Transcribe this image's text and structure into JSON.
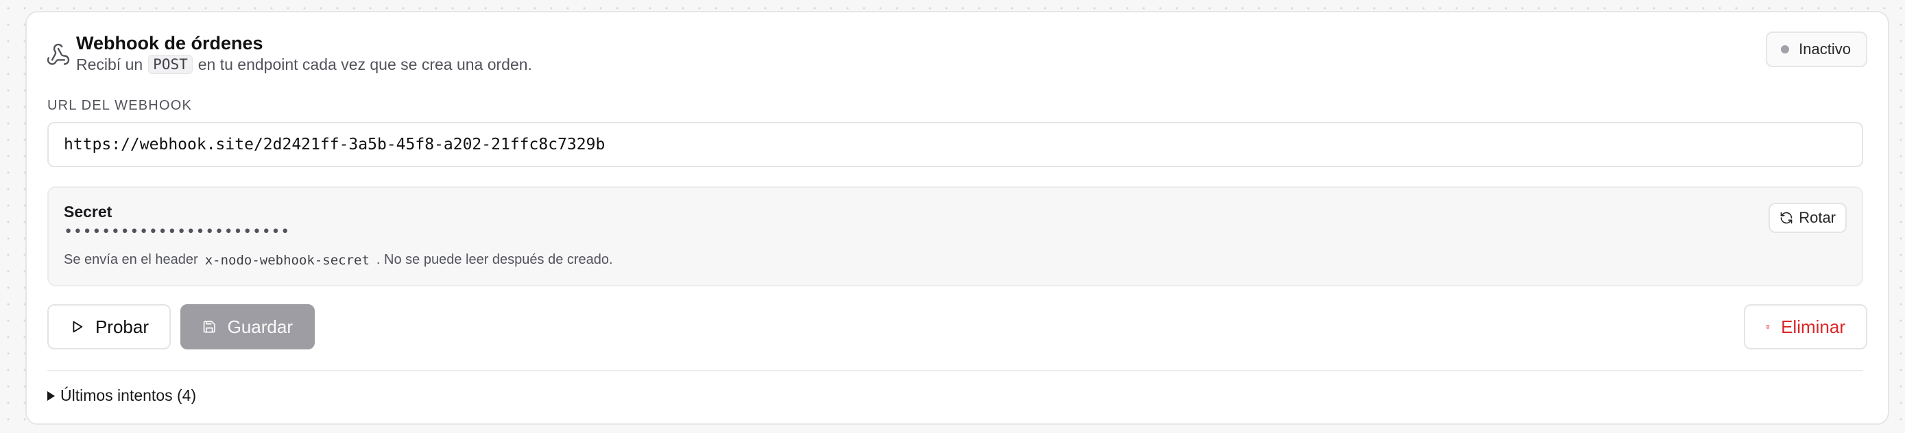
{
  "webhook": {
    "title": "Webhook de órdenes",
    "subtitle_pre": "Recibí un",
    "subtitle_method": "POST",
    "subtitle_post": "en tu endpoint cada vez que se crea una orden.",
    "status": "Inactivo",
    "status_color": "#a1a1aa"
  },
  "url": {
    "label": "URL DEL WEBHOOK",
    "value": "https://webhook.site/2d2421ff-3a5b-45f8-a202-21ffc8c7329b"
  },
  "secret": {
    "label": "Secret",
    "masked": "••••••••••••••••••••••••",
    "hint_pre": "Se envía en el header",
    "hint_header": "x-nodo-webhook-secret",
    "hint_post": ". No se puede leer después de creado.",
    "rotate_label": "Rotar"
  },
  "actions": {
    "test_label": "Probar",
    "save_label": "Guardar",
    "delete_label": "Eliminar",
    "delete_color": "#dc2626"
  },
  "attempts": {
    "label": "Últimos intentos (4)"
  },
  "icons": {
    "header": "webhook-icon",
    "rotate": "refresh-icon",
    "test": "play-icon",
    "save": "save-icon",
    "delete": "trash-icon",
    "expand": "caret-right-icon"
  }
}
